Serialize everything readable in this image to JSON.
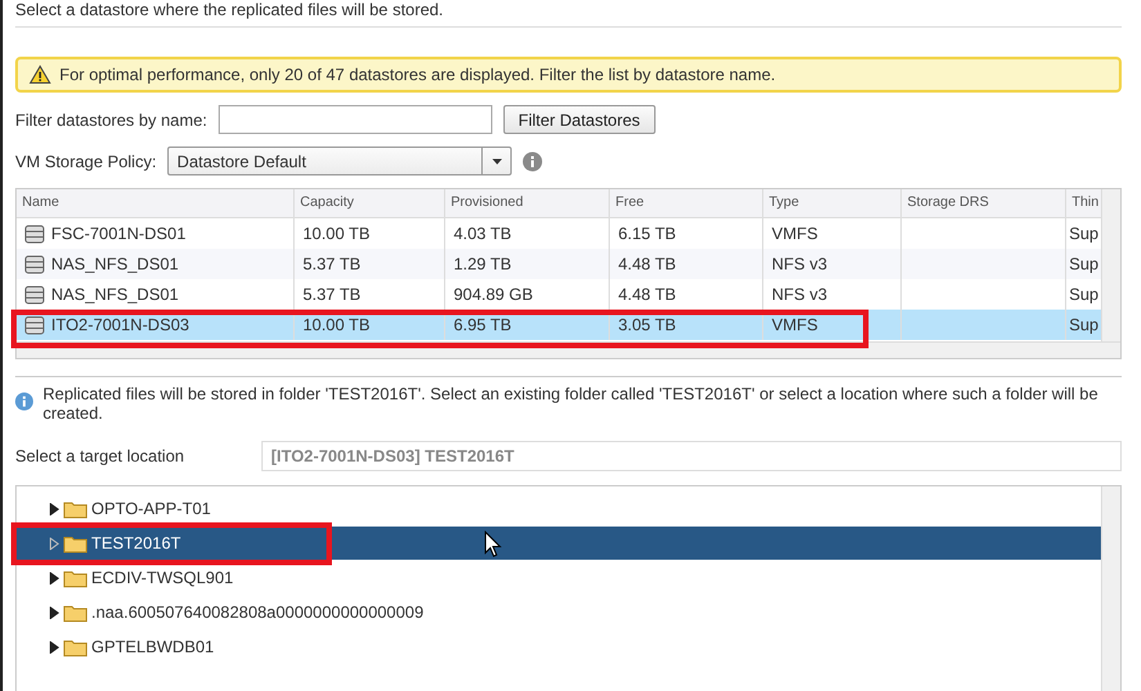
{
  "instruction": "Select a datastore where the replicated files will be stored.",
  "warning": "For optimal performance, only 20 of 47 datastores are displayed. Filter the list by datastore name.",
  "filter": {
    "label": "Filter datastores by name:",
    "button": "Filter Datastores"
  },
  "policy": {
    "label": "VM Storage Policy:",
    "value": "Datastore Default"
  },
  "table": {
    "columns": [
      "Name",
      "Capacity",
      "Provisioned",
      "Free",
      "Type",
      "Storage DRS",
      "Thin"
    ],
    "rows": [
      {
        "cells": [
          "FSC-7001N-DS01",
          "10.00 TB",
          "4.03 TB",
          "6.15 TB",
          "VMFS",
          "",
          "Sup"
        ],
        "selected": false
      },
      {
        "cells": [
          "NAS_NFS_DS01",
          "5.37 TB",
          "1.29 TB",
          "4.48 TB",
          "NFS v3",
          "",
          "Sup"
        ],
        "selected": false
      },
      {
        "cells": [
          "NAS_NFS_DS01",
          "5.37 TB",
          "904.89 GB",
          "4.48 TB",
          "NFS v3",
          "",
          "Sup"
        ],
        "selected": false
      },
      {
        "cells": [
          "ITO2-7001N-DS03",
          "10.00 TB",
          "6.95 TB",
          "3.05 TB",
          "VMFS",
          "",
          "Sup"
        ],
        "selected": true
      }
    ]
  },
  "info": "Replicated files will be stored in folder 'TEST2016T'. Select an existing folder called 'TEST2016T' or select a location where such a folder will be created.",
  "target": {
    "label": "Select a target location",
    "value": "[ITO2-7001N-DS03] TEST2016T"
  },
  "tree": [
    {
      "label": "OPTO-APP-T01",
      "selected": false
    },
    {
      "label": "TEST2016T",
      "selected": true
    },
    {
      "label": "ECDIV-TWSQL901",
      "selected": false
    },
    {
      "label": ".naa.600507640082808a0000000000000009",
      "selected": false
    },
    {
      "label": "GPTELBWDB01",
      "selected": false
    }
  ]
}
